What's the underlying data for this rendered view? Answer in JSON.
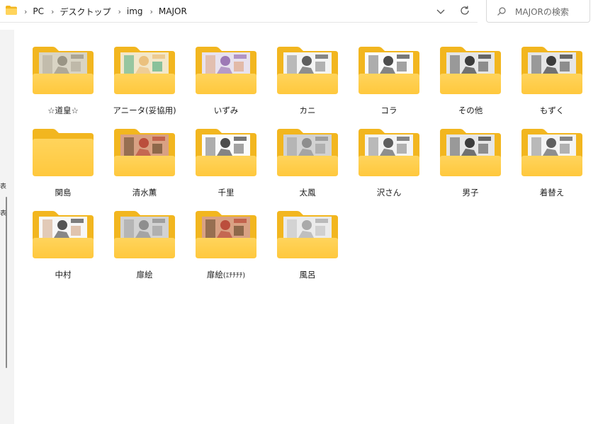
{
  "address_bar": {
    "breadcrumbs": [
      "PC",
      "デスクトップ",
      "img",
      "MAJOR"
    ]
  },
  "search": {
    "placeholder": "MAJORの検索"
  },
  "left_pane": {
    "marks": [
      "表",
      "表"
    ]
  },
  "folders": [
    {
      "name": "☆道皇☆",
      "preview": "sketch"
    },
    {
      "name": "アニータ(妥協用)",
      "preview": "color-girl"
    },
    {
      "name": "いずみ",
      "preview": "color-purple"
    },
    {
      "name": "カニ",
      "preview": "manga"
    },
    {
      "name": "コラ",
      "preview": "manga-face"
    },
    {
      "name": "その他",
      "preview": "manga-dark"
    },
    {
      "name": "もずく",
      "preview": "manga-dark"
    },
    {
      "name": "関島",
      "preview": "empty"
    },
    {
      "name": "清水薫",
      "preview": "color-red"
    },
    {
      "name": "千里",
      "preview": "manga-face"
    },
    {
      "name": "太鳳",
      "preview": "gray"
    },
    {
      "name": "沢さん",
      "preview": "manga"
    },
    {
      "name": "男子",
      "preview": "manga-dark"
    },
    {
      "name": "着替え",
      "preview": "manga"
    },
    {
      "name": "中村",
      "preview": "photo"
    },
    {
      "name": "扉絵",
      "preview": "gray"
    },
    {
      "name": "扉絵",
      "name_suffix": "(ｴﾁﾁﾁﾁ)",
      "preview": "color-red"
    },
    {
      "name": "風呂",
      "preview": "gray-light"
    }
  ],
  "colors": {
    "folder_back": "#f2b61f",
    "folder_front": "#ffd45c",
    "folder_front_bottom": "#ffc83d"
  }
}
